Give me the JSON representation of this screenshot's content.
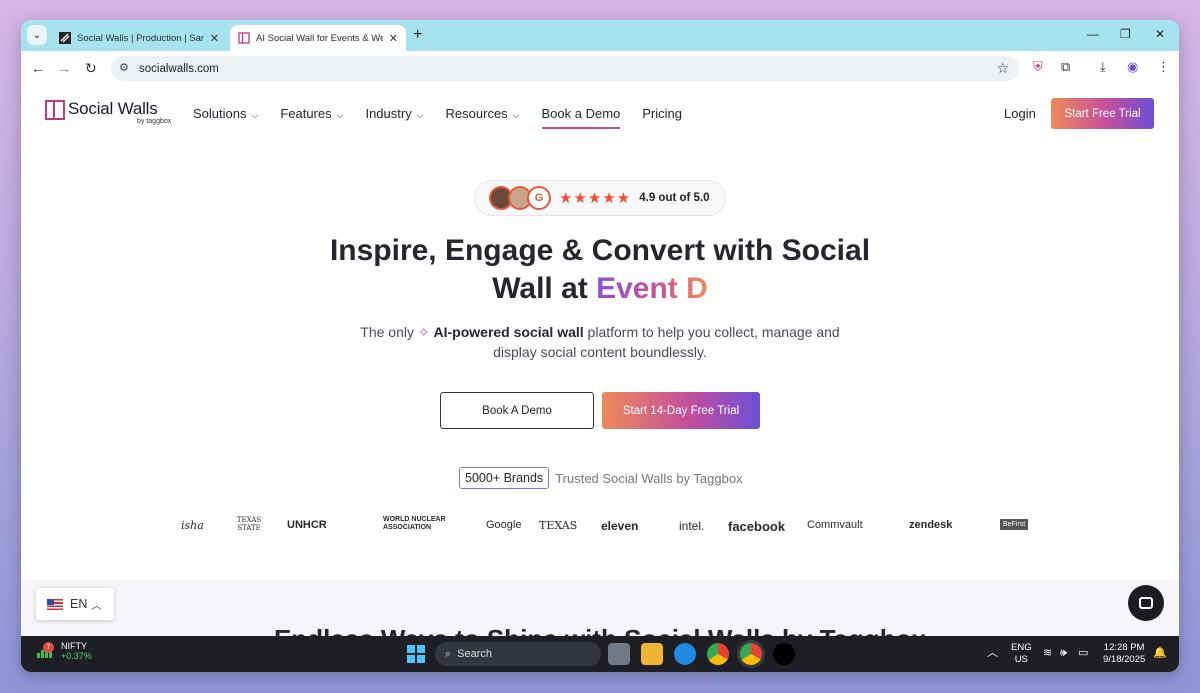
{
  "browser": {
    "tabs": [
      {
        "title": "Social Walls | Production | Sanit",
        "active": false
      },
      {
        "title": "AI Social Wall for Events & Web",
        "active": true
      }
    ],
    "url": "socialwalls.com"
  },
  "site": {
    "logo": {
      "name": "Social Walls",
      "sub": "by taggbox"
    },
    "nav": [
      {
        "label": "Solutions",
        "dropdown": true
      },
      {
        "label": "Features",
        "dropdown": true
      },
      {
        "label": "Industry",
        "dropdown": true
      },
      {
        "label": "Resources",
        "dropdown": true
      },
      {
        "label": "Book a Demo",
        "dropdown": false
      },
      {
        "label": "Pricing",
        "dropdown": false
      }
    ],
    "login": "Login",
    "cta": "Start Free Trial"
  },
  "hero": {
    "rating": {
      "stars": "★★★★★",
      "text": "4.9 out of 5.0",
      "g2": "G"
    },
    "title_line1": "Inspire, Engage & Convert with Social",
    "title_line2_prefix": "Wall at ",
    "title_accent": "Event D",
    "sub_prefix": "The only ",
    "sub_bold": "AI-powered social wall",
    "sub_suffix": " platform to help you collect, manage and",
    "sub_line2": "display social content boundlessly.",
    "btn_demo": "Book A Demo",
    "btn_trial": "Start 14-Day Free Trial",
    "brands_badge": "5000+ Brands",
    "brands_text": "Trusted Social Walls by Taggbox"
  },
  "logos": [
    "isha",
    "TEXAS STATE",
    "UNHCR",
    "WORLD NUCLEAR ASSOCIATION",
    "Google",
    "TEXAS",
    "eleven",
    "intel.",
    "facebook",
    "Commvault",
    "zendesk",
    "BeFirst"
  ],
  "lang": {
    "code": "EN"
  },
  "next_heading": "Endless Ways to Shine with Social Walls by Taggbox",
  "taskbar": {
    "ticker_name": "NIFTY",
    "ticker_change": "+0.37%",
    "notif": "7",
    "search": "Search",
    "lang_line1": "ENG",
    "lang_line2": "US",
    "time": "12:28 PM",
    "date": "9/18/2025"
  }
}
